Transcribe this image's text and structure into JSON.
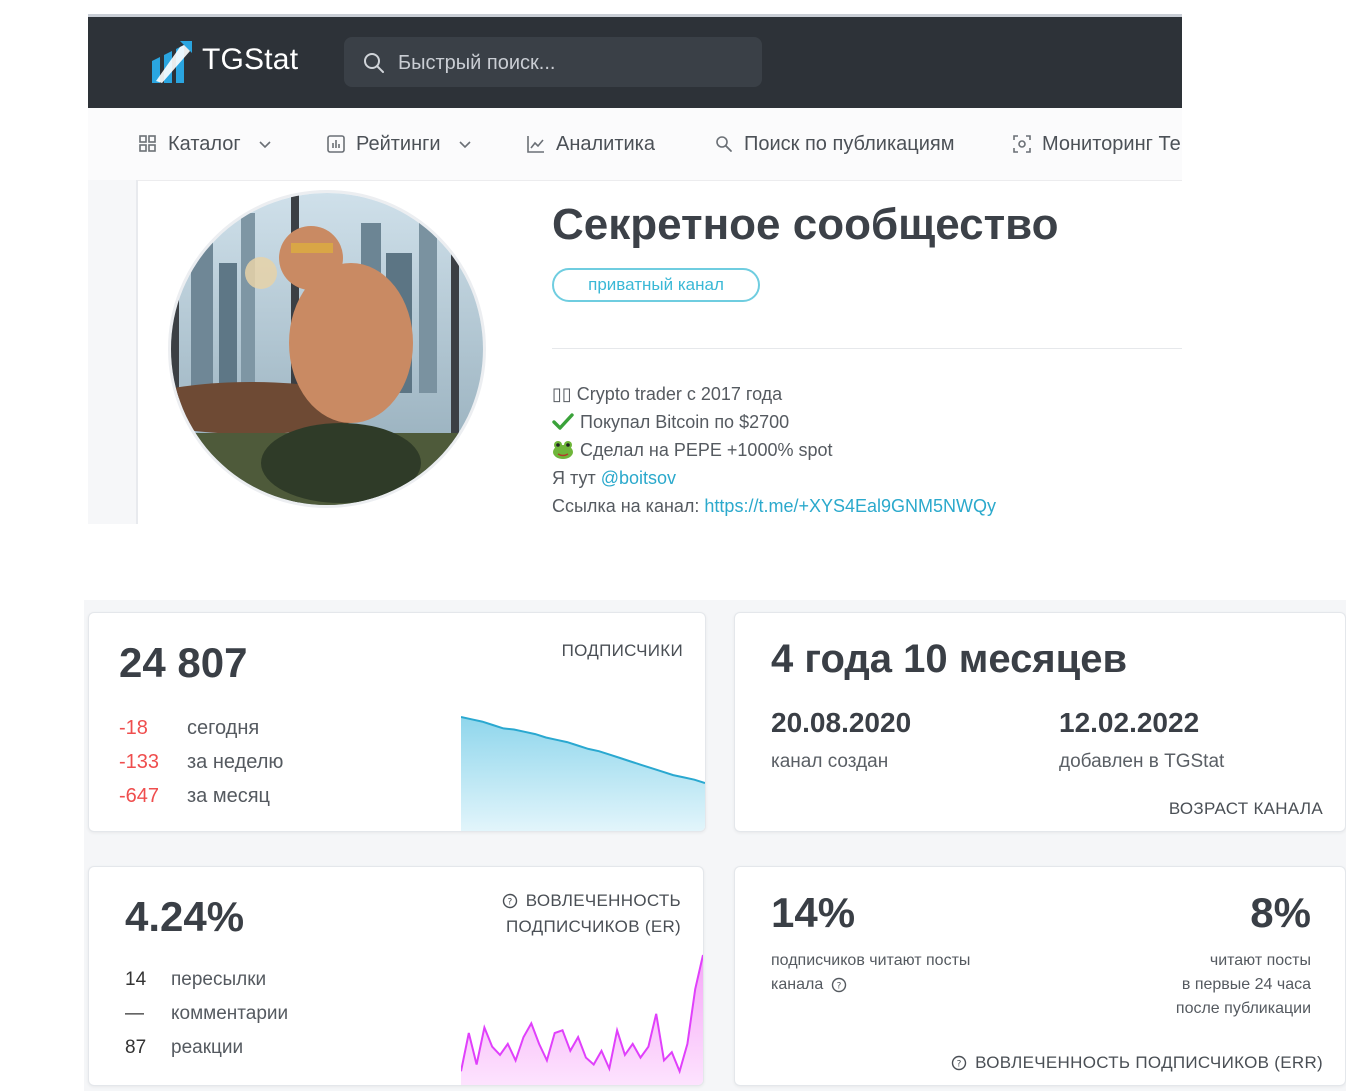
{
  "header": {
    "logo_text": "TGStat",
    "search_placeholder": "Быстрый поиск...",
    "bar_color": "#2d3238"
  },
  "nav": {
    "items": [
      {
        "label": "Каталог",
        "icon": "grid-icon",
        "has_dropdown": true
      },
      {
        "label": "Рейтинги",
        "icon": "bar-chart-icon",
        "has_dropdown": true
      },
      {
        "label": "Аналитика",
        "icon": "line-chart-icon",
        "has_dropdown": false
      },
      {
        "label": "Поиск по публикациям",
        "icon": "search-icon",
        "has_dropdown": false
      },
      {
        "label": "Мониторинг Те",
        "icon": "monitor-icon",
        "has_dropdown": false
      }
    ]
  },
  "channel": {
    "title": "Секретное сообщество",
    "badge": "приватный канал",
    "description": [
      {
        "icon": "flag-icon",
        "text": "▯▯ Crypto trader с 2017 года"
      },
      {
        "icon": "checkmark-icon",
        "text": "Покупал Bitcoin по $2700"
      },
      {
        "icon": "frog-icon",
        "text": "Сделал на PEPE +1000% spot"
      },
      {
        "prefix": "Я тут ",
        "link": "@boitsov"
      },
      {
        "prefix": "Ссылка на канал: ",
        "link": "https://t.me/+XYS4Eal9GNM5NWQy"
      }
    ]
  },
  "subscribers": {
    "count": "24 807",
    "label": "ПОДПИСЧИКИ",
    "deltas": [
      {
        "value": "-18",
        "label": "сегодня"
      },
      {
        "value": "-133",
        "label": "за неделю"
      },
      {
        "value": "-647",
        "label": "за месяц"
      }
    ],
    "color": "#ef4e4e"
  },
  "age": {
    "value": "4 года 10 месяцев",
    "created_date": "20.08.2020",
    "created_label": "канал создан",
    "added_date": "12.02.2022",
    "added_label": "добавлен в TGStat",
    "label": "ВОЗРАСТ КАНАЛА"
  },
  "er": {
    "value": "4.24%",
    "label_line1": "ВОВЛЕЧЕННОСТЬ",
    "label_line2": "ПОДПИСЧИКОВ (ER)",
    "stats": [
      {
        "value": "14",
        "label": "пересылки"
      },
      {
        "value": "—",
        "label": "комментарии"
      },
      {
        "value": "87",
        "label": "реакции"
      }
    ],
    "chart_color": "#e040fb"
  },
  "err": {
    "left_value": "14%",
    "left_text_line1": "подписчиков читают посты",
    "left_text_line2": "канала",
    "right_value": "8%",
    "right_text_line1": "читают посты",
    "right_text_line2": "в первые 24 часа",
    "right_text_line3": "после публикации",
    "label": "ВОВЛЕЧЕННОСТЬ ПОДПИСЧИКОВ (ERR)"
  },
  "charts": {
    "subscribers_trend": [
      100,
      98,
      96,
      93,
      90,
      89,
      87,
      85,
      82,
      80,
      78,
      75,
      72,
      70,
      67,
      64,
      61,
      58,
      55,
      52,
      49,
      47,
      45,
      42
    ],
    "er_trend": [
      10,
      38,
      15,
      42,
      28,
      22,
      30,
      18,
      35,
      45,
      30,
      18,
      38,
      40,
      25,
      35,
      20,
      15,
      25,
      12,
      40,
      22,
      30,
      20,
      28,
      52,
      18,
      24,
      10,
      30,
      70,
      95
    ]
  }
}
